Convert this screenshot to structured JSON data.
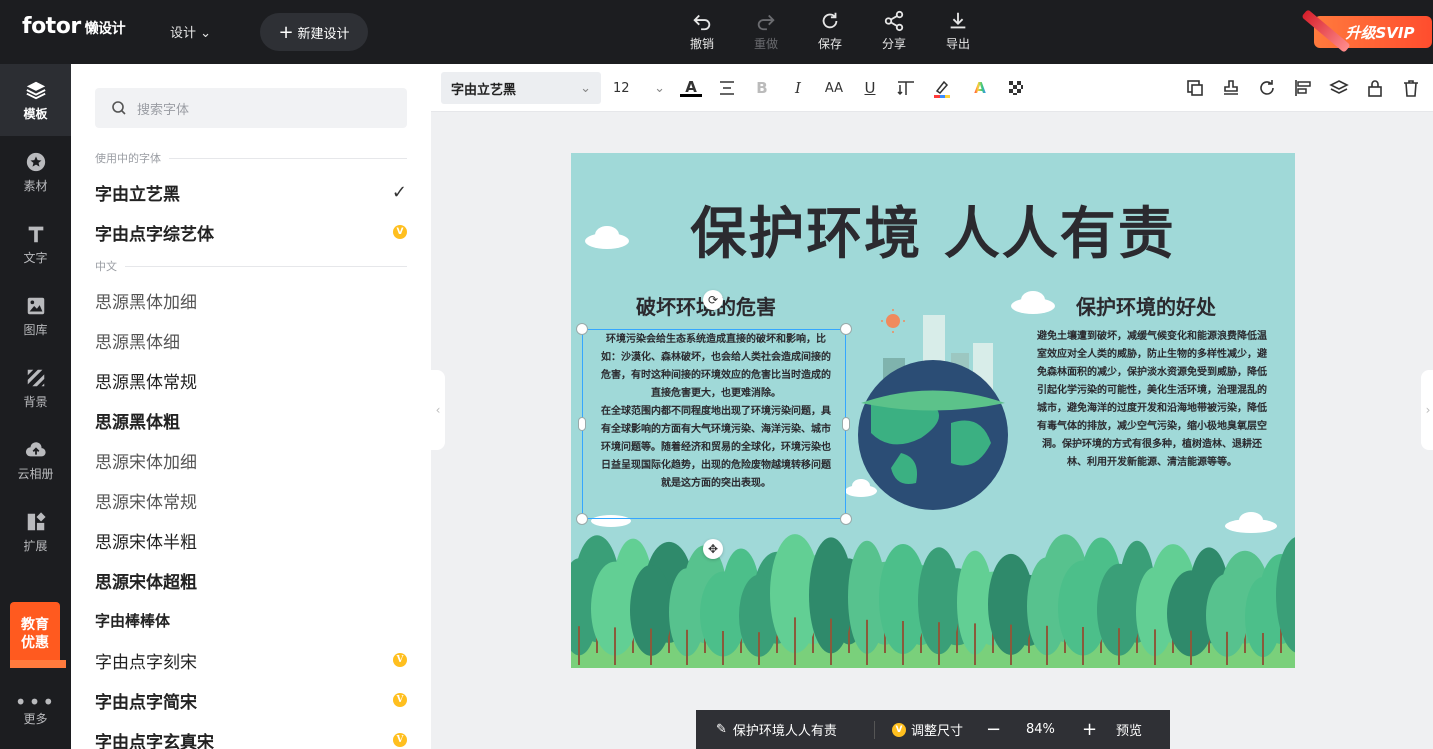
{
  "app": {
    "logo": "fotor",
    "logo_sub": "懒设计"
  },
  "header": {
    "design_menu": "设计",
    "new_design": "新建设计",
    "tools": [
      {
        "label": "撤销",
        "icon": "undo-icon"
      },
      {
        "label": "重做",
        "icon": "redo-icon"
      },
      {
        "label": "保存",
        "icon": "save-icon"
      },
      {
        "label": "分享",
        "icon": "share-icon"
      },
      {
        "label": "导出",
        "icon": "export-icon"
      }
    ],
    "upgrade": "升级SVIP"
  },
  "leftnav": {
    "items": [
      {
        "label": "模板",
        "icon": "layers-icon"
      },
      {
        "label": "素材",
        "icon": "star-icon"
      },
      {
        "label": "文字",
        "icon": "text-icon"
      },
      {
        "label": "图库",
        "icon": "image-icon"
      },
      {
        "label": "背景",
        "icon": "background-icon"
      },
      {
        "label": "云相册",
        "icon": "cloud-upload-icon"
      },
      {
        "label": "扩展",
        "icon": "extend-icon"
      },
      {
        "label": "更多",
        "icon": "more-icon"
      }
    ],
    "edu_line1": "教育",
    "edu_line2": "优惠"
  },
  "fontpanel": {
    "search_placeholder": "搜索字体",
    "section_used": "使用中的字体",
    "used_fonts": [
      {
        "name": "字由立艺黑",
        "status": "selected"
      },
      {
        "name": "字由点字综艺体",
        "status": "vip"
      }
    ],
    "section_chinese": "中文",
    "chinese_fonts": [
      {
        "name": "思源黑体加细"
      },
      {
        "name": "思源黑体细"
      },
      {
        "name": "思源黑体常规"
      },
      {
        "name": "思源黑体粗"
      },
      {
        "name": "思源宋体加细"
      },
      {
        "name": "思源宋体常规"
      },
      {
        "name": "思源宋体半粗"
      },
      {
        "name": "思源宋体超粗"
      },
      {
        "name": "字由棒棒体"
      },
      {
        "name": "字由点字刻宋"
      },
      {
        "name": "字由点字简宋"
      },
      {
        "name": "字由点字玄真宋"
      }
    ]
  },
  "toolbar": {
    "font": "字由立艺黑",
    "size": "12"
  },
  "poster": {
    "title": "保护环境 人人有责",
    "left_heading": "破坏环境的危害",
    "left_para1": "环境污染会给生态系统造成直接的破坏和影响，比如：沙漠化、森林破坏，也会给人类社会造成间接的危害，有时这种间接的环境效应的危害比当时造成的直接危害更大，也更难消除。",
    "left_para2": "在全球范围内都不同程度地出现了环境污染问题，具有全球影响的方面有大气环境污染、海洋污染、城市环境问题等。随着经济和贸易的全球化，环境污染也日益呈现国际化趋势，出现的危险废物越境转移问题就是这方面的突出表现。",
    "right_heading": "保护环境的好处",
    "right_para": "避免土壤遭到破坏，减缓气候变化和能源浪费降低温室效应对全人类的威胁，防止生物的多样性减少，避免森林面积的减少，保护淡水资源免受到威胁，降低引起化学污染的可能性，美化生活环境，治理混乱的城市，避免海洋的过度开发和沿海地带被污染，降低有毒气体的排放，减少空气污染，缩小极地臭氧层空洞。保护环境的方式有很多种，植树造林、退耕还林、利用开发新能源、清洁能源等等。"
  },
  "bottombar": {
    "doc_name": "保护环境人人有责",
    "resize": "调整尺寸",
    "zoom": "84%",
    "preview": "预览"
  }
}
